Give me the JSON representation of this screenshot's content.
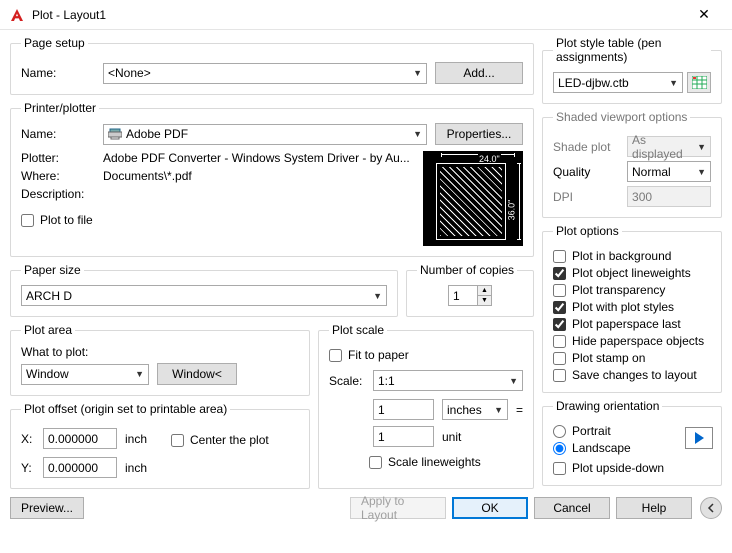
{
  "window": {
    "title": "Plot - Layout1"
  },
  "pageSetup": {
    "legend": "Page setup",
    "nameLabel": "Name:",
    "nameValue": "<None>",
    "addBtn": "Add..."
  },
  "printer": {
    "legend": "Printer/plotter",
    "nameLabel": "Name:",
    "nameValue": "Adobe PDF",
    "propertiesBtn": "Properties...",
    "plotterLabel": "Plotter:",
    "plotterValue": "Adobe PDF Converter - Windows System Driver - by Au...",
    "whereLabel": "Where:",
    "whereValue": "Documents\\*.pdf",
    "descLabel": "Description:",
    "plotToFile": "Plot to file",
    "preview": {
      "top": "24.0\"",
      "right": "36.0\""
    }
  },
  "paperSize": {
    "legend": "Paper size",
    "value": "ARCH D"
  },
  "copies": {
    "legend": "Number of copies",
    "value": "1"
  },
  "plotArea": {
    "legend": "Plot area",
    "whatLabel": "What to plot:",
    "whatValue": "Window",
    "windowBtn": "Window<"
  },
  "plotOffset": {
    "legend": "Plot offset (origin set to printable area)",
    "xLabel": "X:",
    "xValue": "0.000000",
    "xUnit": "inch",
    "yLabel": "Y:",
    "yValue": "0.000000",
    "yUnit": "inch",
    "centerLabel": "Center the plot"
  },
  "plotScale": {
    "legend": "Plot scale",
    "fitLabel": "Fit to paper",
    "scaleLabel": "Scale:",
    "scaleValue": "1:1",
    "num": "1",
    "numUnit": "inches",
    "eq": "=",
    "den": "1",
    "denUnit": "unit",
    "scaleLw": "Scale lineweights"
  },
  "plotStyle": {
    "legend": "Plot style table (pen assignments)",
    "value": "LED-djbw.ctb"
  },
  "shaded": {
    "legend": "Shaded viewport options",
    "shadeLabel": "Shade plot",
    "shadeValue": "As displayed",
    "qualityLabel": "Quality",
    "qualityValue": "Normal",
    "dpiLabel": "DPI",
    "dpiValue": "300"
  },
  "plotOptions": {
    "legend": "Plot options",
    "bg": "Plot in background",
    "lw": "Plot object lineweights",
    "trans": "Plot transparency",
    "styles": "Plot with plot styles",
    "pslast": "Plot paperspace last",
    "hideps": "Hide paperspace objects",
    "stamp": "Plot stamp on",
    "save": "Save changes to layout"
  },
  "orient": {
    "legend": "Drawing orientation",
    "portrait": "Portrait",
    "landscape": "Landscape",
    "upside": "Plot upside-down"
  },
  "footer": {
    "preview": "Preview...",
    "apply": "Apply to Layout",
    "ok": "OK",
    "cancel": "Cancel",
    "help": "Help"
  }
}
